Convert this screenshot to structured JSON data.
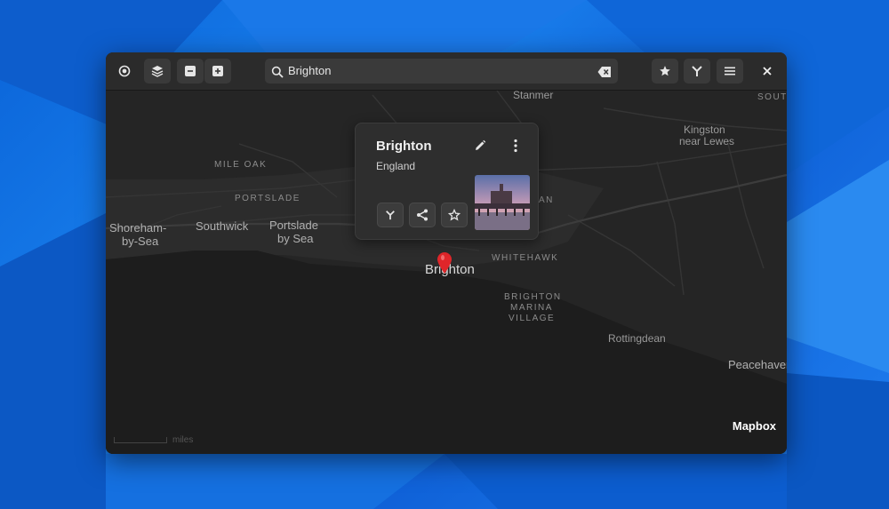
{
  "desktop": {
    "colors": {
      "primary": "#0a63d8",
      "light": "#2b8cf2"
    }
  },
  "headerbar": {
    "buttons_left": [
      {
        "name": "locate-button",
        "icon": "locate-icon"
      },
      {
        "name": "layers-button",
        "icon": "layers-icon"
      },
      {
        "name": "zoom-out-button",
        "icon": "minus-icon"
      },
      {
        "name": "zoom-in-button",
        "icon": "plus-icon"
      }
    ],
    "search": {
      "value": "Brighton",
      "placeholder": ""
    },
    "buttons_right": [
      {
        "name": "favorites-button",
        "icon": "star-icon"
      },
      {
        "name": "route-button",
        "icon": "route-icon"
      },
      {
        "name": "menu-button",
        "icon": "hamburger-icon"
      },
      {
        "name": "close-button",
        "icon": "close-icon"
      }
    ]
  },
  "map": {
    "labels": {
      "stanmer": "Stanmer",
      "south": "SOUTH",
      "kingston": "Kingston",
      "near_lewes": "near Lewes",
      "mile_oak": "MILE OAK",
      "portslade_caps": "PORTSLADE",
      "shoreham": "Shoreham-",
      "by_sea_1": "by-Sea",
      "southwick": "Southwick",
      "portslade": "Portslade",
      "by_sea_2": "by Sea",
      "an": "AN",
      "whitehawk": "WHITEHAWK",
      "brighton": "Brighton",
      "marina_1": "BRIGHTON",
      "marina_2": "MARINA",
      "marina_3": "VILLAGE",
      "rottingdean": "Rottingdean",
      "peacehaven": "Peacehaven"
    },
    "attribution": "Mapbox",
    "scale_label": "miles"
  },
  "popover": {
    "title": "Brighton",
    "subtitle": "England",
    "actions": [
      "route",
      "share",
      "favorite"
    ]
  }
}
